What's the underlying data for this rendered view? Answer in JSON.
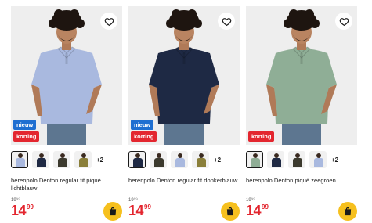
{
  "products": [
    {
      "title": "herenpolo Denton regular fit piqué lichtblauw",
      "old_price": "19⁹⁹",
      "price_euros": "14",
      "price_cents": "99",
      "badges": [
        "nieuw",
        "korting"
      ],
      "more_colors": "+2",
      "shirt_color": "#a9b9df",
      "swatch_colors": [
        "#a9b9df",
        "#1f2a44",
        "#3c3a2e",
        "#8a7f3a"
      ],
      "selected_swatch": 0
    },
    {
      "title": "herenpolo Denton regular fit donkerblauw",
      "old_price": "19⁹⁹",
      "price_euros": "14",
      "price_cents": "99",
      "badges": [
        "nieuw",
        "korting"
      ],
      "more_colors": "+2",
      "shirt_color": "#1e2944",
      "swatch_colors": [
        "#1e2944",
        "#3c3a2e",
        "#a9b9df",
        "#8a7f3a"
      ],
      "selected_swatch": 0
    },
    {
      "title": "herenpolo Denton piqué zeegroen",
      "old_price": "19⁹⁹",
      "price_euros": "14",
      "price_cents": "99",
      "badges": [
        "korting"
      ],
      "more_colors": "+2",
      "shirt_color": "#8fae96",
      "swatch_colors": [
        "#8fae96",
        "#1f2a44",
        "#3c3a2e",
        "#a9b9df"
      ],
      "selected_swatch": 0
    }
  ],
  "colors": {
    "price_red": "#e3262f",
    "badge_new": "#1f6fd1",
    "badge_sale": "#e3262f",
    "cart_yellow": "#f6c01e"
  },
  "icons": [
    "heart-icon",
    "shopping-bag-icon"
  ]
}
